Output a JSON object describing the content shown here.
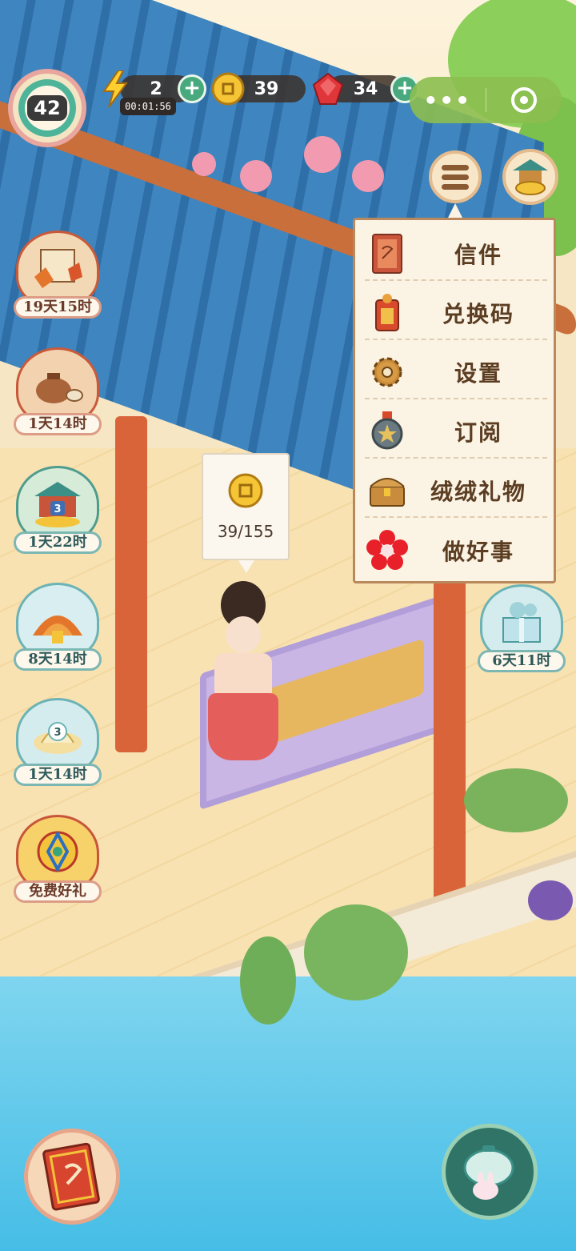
{
  "hud": {
    "level": "42",
    "energy": {
      "value": "2",
      "timer": "00:01:56"
    },
    "coins": {
      "value": "39"
    },
    "gems": {
      "value": "34"
    },
    "plus_label": "+",
    "more_dots": "•••"
  },
  "menu": {
    "items": [
      {
        "label": "信件",
        "icon": "letter-icon"
      },
      {
        "label": "兑换码",
        "icon": "redeem-code-icon"
      },
      {
        "label": "设置",
        "icon": "gear-icon"
      },
      {
        "label": "订阅",
        "icon": "subscribe-icon"
      },
      {
        "label": "绒绒礼物",
        "icon": "gift-chest-icon"
      },
      {
        "label": "做好事",
        "icon": "red-flower-icon"
      }
    ]
  },
  "coin_tooltip": {
    "text": "39/155"
  },
  "left_events": [
    {
      "timer": "19天15时",
      "style": "red"
    },
    {
      "timer": "1天14时",
      "style": "red"
    },
    {
      "timer": "1天22时",
      "style": "teal",
      "badge": "3"
    },
    {
      "timer": "8天14时",
      "style": "teal"
    },
    {
      "timer": "1天14时",
      "style": "teal",
      "badge": "3"
    },
    {
      "timer": "免费好礼",
      "style": "red"
    }
  ],
  "right_event": {
    "timer": "6天11时"
  },
  "colors": {
    "accent_green": "#49a97e",
    "menu_text": "#5b3d22",
    "roof_blue": "#3f85bf",
    "pillar_red": "#d9643a"
  }
}
